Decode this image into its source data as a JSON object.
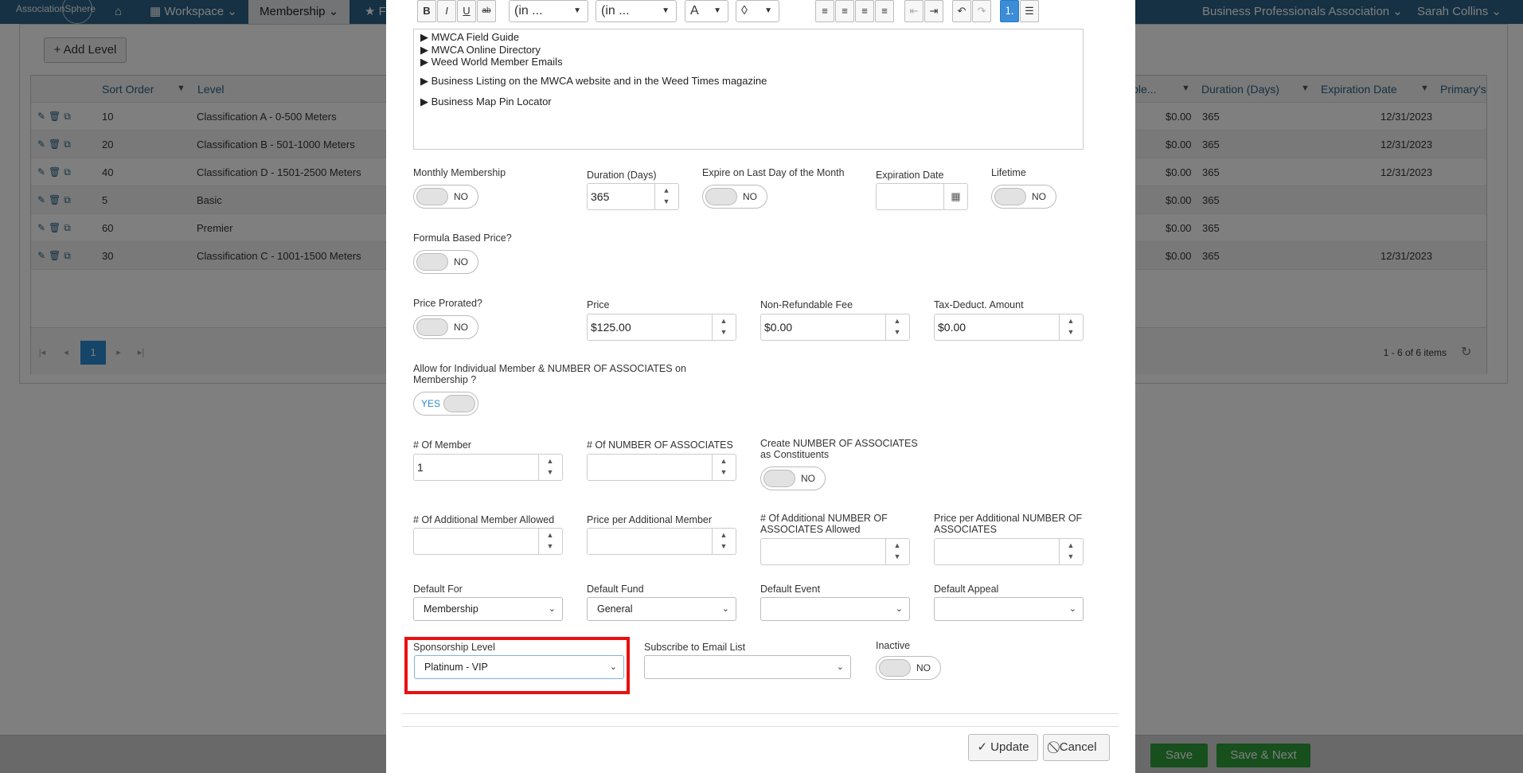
{
  "app": {
    "logo": "AssociationSphere",
    "nav": {
      "workspace": "Workspace",
      "membership": "Membership",
      "f": "F"
    },
    "org": "Business Professionals Association",
    "user": "Sarah Collins"
  },
  "page": {
    "add_level": "+ Add Level",
    "grid": {
      "headers": {
        "sort_order": "Sort Order",
        "level": "Level",
        "eligible": "ible...",
        "duration": "Duration (Days)",
        "expiration": "Expiration Date",
        "primary": "Primary's"
      },
      "rows": [
        {
          "sort": "10",
          "level": "Classification A - 0-500 Meters",
          "amount": "$0.00",
          "duration": "365",
          "expiration": "12/31/2023"
        },
        {
          "sort": "20",
          "level": "Classification B - 501-1000 Meters",
          "amount": "$0.00",
          "duration": "365",
          "expiration": "12/31/2023"
        },
        {
          "sort": "40",
          "level": "Classification D - 1501-2500 Meters",
          "amount": "$0.00",
          "duration": "365",
          "expiration": "12/31/2023"
        },
        {
          "sort": "5",
          "level": "Basic",
          "amount": "$0.00",
          "duration": "365",
          "expiration": ""
        },
        {
          "sort": "60",
          "level": "Premier",
          "amount": "$0.00",
          "duration": "365",
          "expiration": ""
        },
        {
          "sort": "30",
          "level": "Classification C - 1001-1500 Meters",
          "amount": "$0.00",
          "duration": "365",
          "expiration": "12/31/2023"
        }
      ],
      "pager": {
        "current": "1",
        "info": "1 - 6 of 6 items"
      }
    },
    "footer": {
      "save": "Save",
      "save_next": "Save & Next"
    }
  },
  "modal": {
    "toolbar": {
      "bold": "B",
      "italic": "I",
      "underline": "U",
      "strike": "ab",
      "font_name": "(in ...",
      "font_size": "(in ...",
      "font_color": "A",
      "bg_color": "◊"
    },
    "editor_lines": [
      "▶ MWCA Field Guide",
      "▶ MWCA Online Directory",
      "▶ Weed World Member Emails",
      "▶ Business Listing on the MWCA website and in the Weed Times magazine",
      "▶ Business Map Pin Locator"
    ],
    "fields": {
      "monthly_membership": {
        "label": "Monthly Membership",
        "toggle": "NO"
      },
      "duration": {
        "label": "Duration (Days)",
        "value": "365"
      },
      "expire_last_day": {
        "label": "Expire on Last Day of the Month",
        "toggle": "NO"
      },
      "expiration_date": {
        "label": "Expiration Date",
        "value": ""
      },
      "lifetime": {
        "label": "Lifetime",
        "toggle": "NO"
      },
      "formula_price": {
        "label": "Formula Based Price?",
        "toggle": "NO"
      },
      "price_prorated": {
        "label": "Price Prorated?",
        "toggle": "NO"
      },
      "price": {
        "label": "Price",
        "value": "$125.00"
      },
      "non_refundable": {
        "label": "Non-Refundable Fee",
        "value": "$0.00"
      },
      "tax_deduct": {
        "label": "Tax-Deduct. Amount",
        "value": "$0.00"
      },
      "allow_individual": {
        "label": "Allow for Individual Member & NUMBER OF ASSOCIATES on Membership ?",
        "toggle": "YES"
      },
      "num_member": {
        "label": "# Of Member",
        "value": "1"
      },
      "num_associates": {
        "label": "# Of NUMBER OF ASSOCIATES",
        "value": ""
      },
      "create_associates": {
        "label": "Create NUMBER OF ASSOCIATES as Constituents",
        "toggle": "NO"
      },
      "additional_member": {
        "label": "# Of Additional Member Allowed",
        "value": ""
      },
      "price_additional_member": {
        "label": "Price per Additional Member",
        "value": ""
      },
      "additional_associates": {
        "label": "# Of Additional NUMBER OF ASSOCIATES Allowed",
        "value": ""
      },
      "price_additional_associates": {
        "label": "Price per Additional NUMBER OF ASSOCIATES",
        "value": ""
      },
      "default_for": {
        "label": "Default For",
        "value": "Membership"
      },
      "default_fund": {
        "label": "Default Fund",
        "value": "General"
      },
      "default_event": {
        "label": "Default Event",
        "value": ""
      },
      "default_appeal": {
        "label": "Default Appeal",
        "value": ""
      },
      "sponsorship_level": {
        "label": "Sponsorship Level",
        "value": "Platinum - VIP"
      },
      "subscribe_email": {
        "label": "Subscribe to Email List",
        "value": ""
      },
      "inactive": {
        "label": "Inactive",
        "toggle": "NO"
      }
    },
    "buttons": {
      "update": "✓ Update",
      "cancel": "⃠ Cancel"
    }
  }
}
